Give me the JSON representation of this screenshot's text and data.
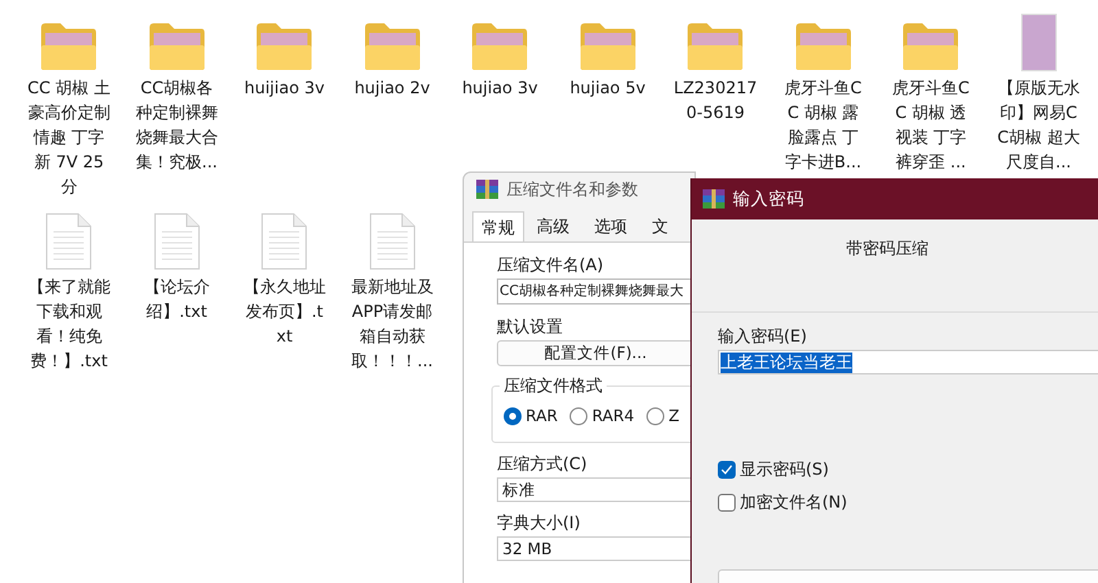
{
  "desktop": {
    "items": [
      {
        "kind": "folder",
        "label": "CC 胡椒 土豪高价定制情趣 丁字新 7V 25分"
      },
      {
        "kind": "folder",
        "label": "CC胡椒各种定制裸舞烧舞最大合集！究极..."
      },
      {
        "kind": "folder",
        "label": "huijiao 3v"
      },
      {
        "kind": "folder",
        "label": "hujiao 2v"
      },
      {
        "kind": "folder",
        "label": "hujiao 3v"
      },
      {
        "kind": "folder",
        "label": "hujiao 5v"
      },
      {
        "kind": "folder",
        "label": "LZ2302170-5619"
      },
      {
        "kind": "folder",
        "label": "虎牙斗鱼CC 胡椒 露脸露点 丁字卡进B..."
      },
      {
        "kind": "folder",
        "label": "虎牙斗鱼CC 胡椒 透视装 丁字裤穿歪 ..."
      },
      {
        "kind": "image",
        "label": "【原版无水印】网易CC胡椒 超大尺度自..."
      },
      {
        "kind": "text-file",
        "label": "【来了就能下载和观看！纯免费！】.txt"
      },
      {
        "kind": "text-file",
        "label": "【论坛介绍】.txt"
      },
      {
        "kind": "text-file",
        "label": "【永久地址发布页】.txt"
      },
      {
        "kind": "text-file",
        "label": "最新地址及APP请发邮箱自动获取！！！..."
      }
    ]
  },
  "archive_dialog": {
    "title": "压缩文件名和参数",
    "tabs": [
      {
        "label": "常规",
        "selected": true
      },
      {
        "label": "高级",
        "selected": false
      },
      {
        "label": "选项",
        "selected": false
      },
      {
        "label": "文",
        "selected": false
      }
    ],
    "archive_name": {
      "label": "压缩文件名(A)",
      "value": "CC胡椒各种定制裸舞烧舞最大"
    },
    "default_settings": {
      "label": "默认设置",
      "button": "配置文件(F)..."
    },
    "format": {
      "title": "压缩文件格式",
      "options": [
        {
          "label": "RAR",
          "selected": true
        },
        {
          "label": "RAR4",
          "selected": false
        },
        {
          "label": "Z",
          "selected": false
        }
      ]
    },
    "method": {
      "label": "压缩方式(C)",
      "value": "标准"
    },
    "dictionary": {
      "label": "字典大小(I)",
      "value": "32 MB"
    }
  },
  "password_dialog": {
    "title": "输入密码",
    "heading": "带密码压缩",
    "password_label": "输入密码(E)",
    "password": "上老王论坛当老王",
    "options": [
      {
        "label": "显示密码(S)",
        "checked": true
      },
      {
        "label": "加密文件名(N)",
        "checked": false
      }
    ]
  }
}
